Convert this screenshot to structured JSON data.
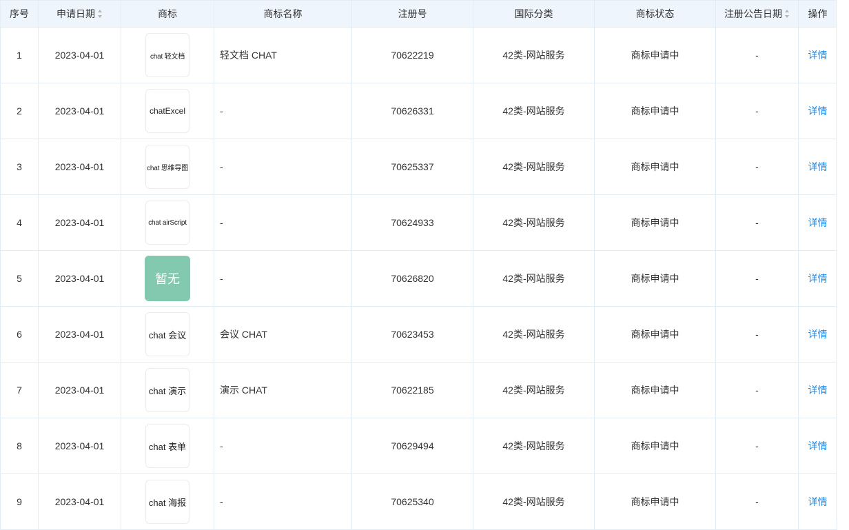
{
  "table": {
    "headers": {
      "index": "序号",
      "apply_date": "申请日期",
      "logo": "商标",
      "name": "商标名称",
      "reg_no": "注册号",
      "intl_class": "国际分类",
      "status": "商标状态",
      "publish_date": "注册公告日期",
      "action": "操作"
    },
    "sortable_columns": [
      "申请日期",
      "注册公告日期"
    ],
    "rows": [
      {
        "index": "1",
        "apply_date": "2023-04-01",
        "logo_text": "chat 轻文档",
        "name": "轻文档 CHAT",
        "reg_no": "70622219",
        "intl_class": "42类-网站服务",
        "status": "商标申请中",
        "publish_date": "-",
        "action": "详情"
      },
      {
        "index": "2",
        "apply_date": "2023-04-01",
        "logo_text": "chatExcel",
        "name": "-",
        "reg_no": "70626331",
        "intl_class": "42类-网站服务",
        "status": "商标申请中",
        "publish_date": "-",
        "action": "详情"
      },
      {
        "index": "3",
        "apply_date": "2023-04-01",
        "logo_text": "chat 思维导图",
        "name": "-",
        "reg_no": "70625337",
        "intl_class": "42类-网站服务",
        "status": "商标申请中",
        "publish_date": "-",
        "action": "详情"
      },
      {
        "index": "4",
        "apply_date": "2023-04-01",
        "logo_text": "chat airScript",
        "name": "-",
        "reg_no": "70624933",
        "intl_class": "42类-网站服务",
        "status": "商标申请中",
        "publish_date": "-",
        "action": "详情"
      },
      {
        "index": "5",
        "apply_date": "2023-04-01",
        "logo_text": "暂无",
        "name": "-",
        "reg_no": "70626820",
        "intl_class": "42类-网站服务",
        "status": "商标申请中",
        "publish_date": "-",
        "action": "详情"
      },
      {
        "index": "6",
        "apply_date": "2023-04-01",
        "logo_text": "chat 会议",
        "name": "会议 CHAT",
        "reg_no": "70623453",
        "intl_class": "42类-网站服务",
        "status": "商标申请中",
        "publish_date": "-",
        "action": "详情"
      },
      {
        "index": "7",
        "apply_date": "2023-04-01",
        "logo_text": "chat 演示",
        "name": "演示 CHAT",
        "reg_no": "70622185",
        "intl_class": "42类-网站服务",
        "status": "商标申请中",
        "publish_date": "-",
        "action": "详情"
      },
      {
        "index": "8",
        "apply_date": "2023-04-01",
        "logo_text": "chat 表单",
        "name": "-",
        "reg_no": "70629494",
        "intl_class": "42类-网站服务",
        "status": "商标申请中",
        "publish_date": "-",
        "action": "详情"
      },
      {
        "index": "9",
        "apply_date": "2023-04-01",
        "logo_text": "chat 海报",
        "name": "-",
        "reg_no": "70625340",
        "intl_class": "42类-网站服务",
        "status": "商标申请中",
        "publish_date": "-",
        "action": "详情"
      }
    ]
  },
  "colors": {
    "header_bg": "#eef5fd",
    "border": "#e4ecf4",
    "link": "#1a8aea",
    "placeholder_logo_bg": "#83c9af"
  }
}
